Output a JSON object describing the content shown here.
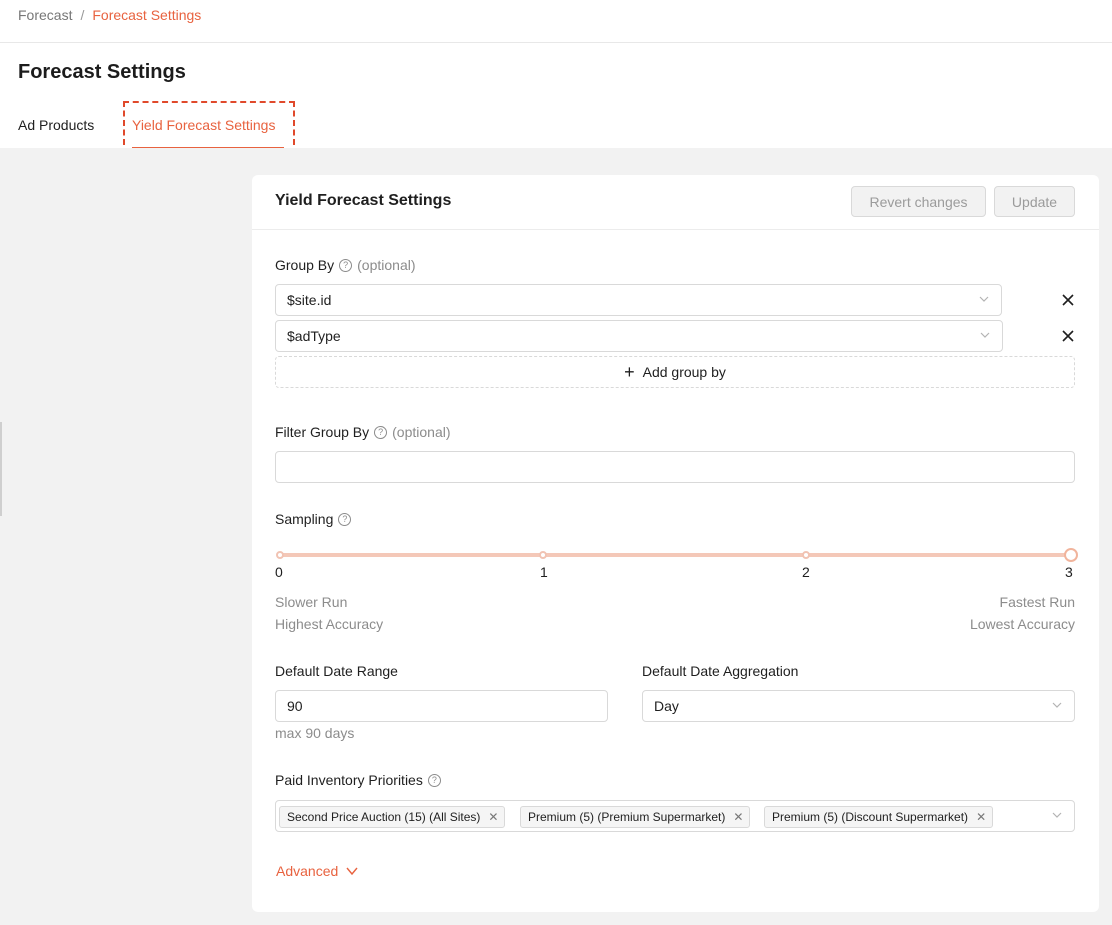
{
  "breadcrumb": {
    "root": "Forecast",
    "separator": "/",
    "current": "Forecast Settings"
  },
  "page_title": "Forecast Settings",
  "tabs": [
    {
      "label": "Ad Products",
      "active": false
    },
    {
      "label": "Yield Forecast Settings",
      "active": true
    }
  ],
  "card": {
    "title": "Yield Forecast Settings",
    "revert_label": "Revert changes",
    "update_label": "Update"
  },
  "group_by": {
    "label": "Group By",
    "optional": "(optional)",
    "items": [
      "$site.id",
      "$adType"
    ],
    "add_label": "Add group by"
  },
  "filter_group_by": {
    "label": "Filter Group By",
    "optional": "(optional)",
    "value": ""
  },
  "sampling": {
    "label": "Sampling",
    "ticks": [
      "0",
      "1",
      "2",
      "3"
    ],
    "value": 3,
    "left_caption_1": "Slower Run",
    "left_caption_2": "Highest Accuracy",
    "right_caption_1": "Fastest Run",
    "right_caption_2": "Lowest Accuracy"
  },
  "date_range": {
    "label": "Default Date Range",
    "value": "90",
    "hint": "max 90 days"
  },
  "date_aggregation": {
    "label": "Default Date Aggregation",
    "value": "Day"
  },
  "paid_inventory": {
    "label": "Paid Inventory Priorities",
    "tags": [
      "Second Price Auction (15) (All Sites)",
      "Premium (5) (Premium Supermarket)",
      "Premium (5) (Discount Supermarket)"
    ]
  },
  "advanced_label": "Advanced",
  "colors": {
    "accent": "#e8623f",
    "highlight_border": "#e0492b",
    "slider_track": "#f4c8b8"
  }
}
